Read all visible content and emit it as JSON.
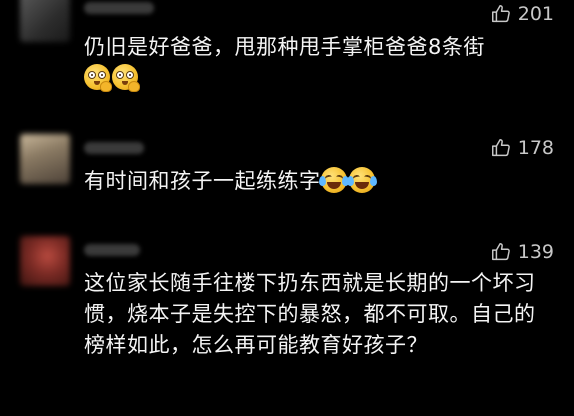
{
  "comments": [
    {
      "likes": "201",
      "text": "仍旧是好爸爸，甩那种甩手掌柜爸爸8条街",
      "emoji": [
        "eyes-hand-emoji",
        "eyes-hand-emoji"
      ]
    },
    {
      "likes": "178",
      "text": "有时间和孩子一起练练字",
      "emoji": [
        "tears-of-joy-emoji",
        "tears-of-joy-emoji"
      ]
    },
    {
      "likes": "139",
      "text": "这位家长随手往楼下扔东西就是长期的一个坏习惯，烧本子是失控下的暴怒，都不可取。自己的榜样如此，怎么再可能教育好孩子？"
    }
  ],
  "icons": {
    "like": "thumbs-up-icon"
  },
  "colors": {
    "background": "#000000",
    "text": "#f4f4f4",
    "likes_text": "#c8c8c8"
  }
}
